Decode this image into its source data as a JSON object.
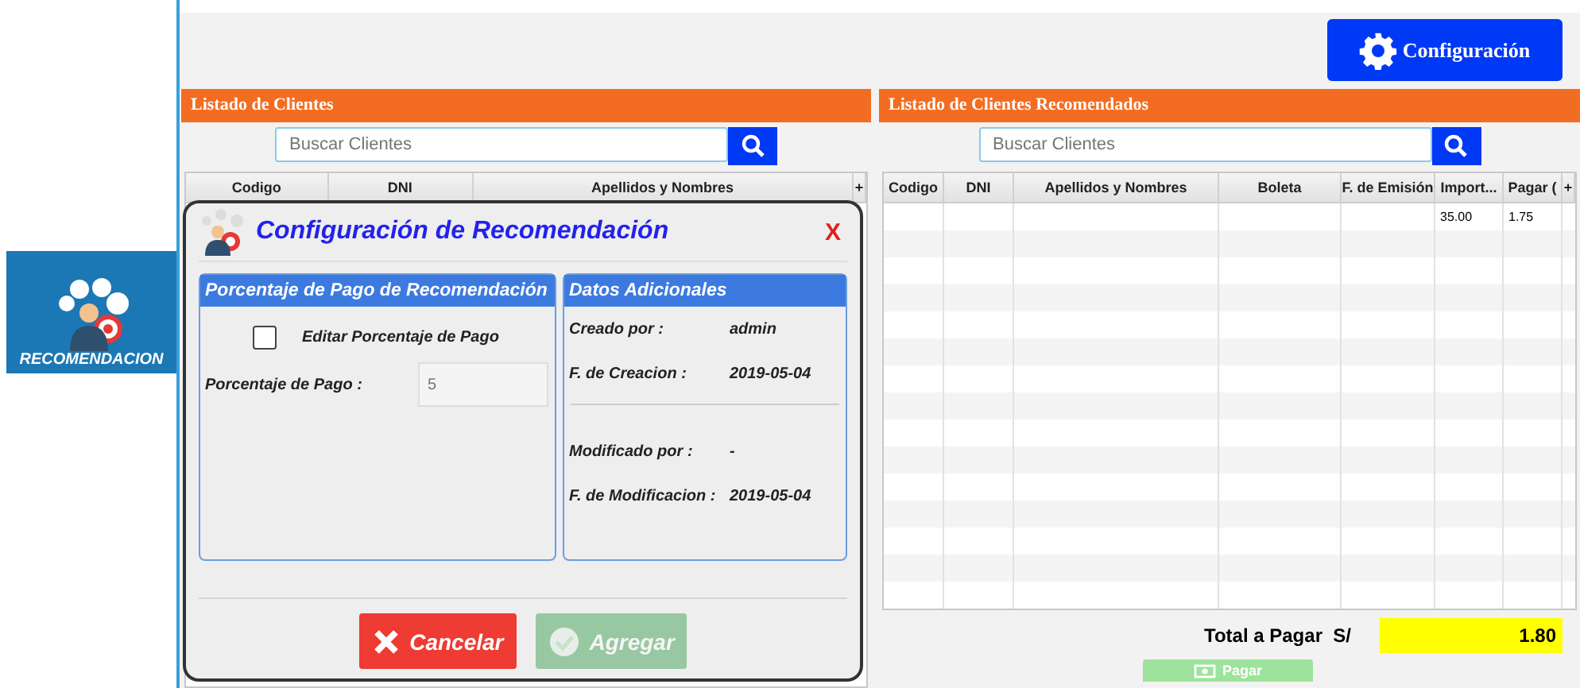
{
  "sidebar_tile": {
    "label": "RECOMENDACION"
  },
  "toolbar": {
    "config_button": "Configuración"
  },
  "clients_panel": {
    "title": "Listado de Clientes",
    "search": {
      "placeholder": "Buscar Clientes"
    },
    "columns": [
      "Codigo",
      "DNI",
      "Apellidos y Nombres"
    ],
    "add_column": "+"
  },
  "recommended_panel": {
    "title": "Listado de Clientes Recomendados",
    "search": {
      "placeholder": "Buscar Clientes"
    },
    "columns": [
      "Codigo",
      "DNI",
      "Apellidos y Nombres",
      "Boleta",
      "F. de Emisión",
      "Import...",
      "Pagar ("
    ],
    "add_column": "+",
    "rows": [
      {
        "cells": [
          "",
          "",
          "",
          "",
          "",
          "35.00",
          "1.75"
        ]
      }
    ]
  },
  "total": {
    "label": "Total a Pagar  S/",
    "value": "1.80"
  },
  "pay_button": {
    "label": "Pagar",
    "disabled": true
  },
  "dialog": {
    "title": "Configuración de Recomendación",
    "close": "X",
    "left_group": {
      "title": "Porcentaje de Pago de Recomendación",
      "checkbox": {
        "label": "Editar Porcentaje de Pago",
        "checked": false
      },
      "field": {
        "label": "Porcentaje de Pago :",
        "value": "5",
        "disabled": true
      }
    },
    "right_group": {
      "title": "Datos Adicionales",
      "sections": [
        [
          {
            "label": "Creado por :",
            "value": "admin"
          },
          {
            "label": "F. de Creacion :",
            "value": "2019-05-04"
          }
        ],
        [
          {
            "label": "Modificado por :",
            "value": "-"
          },
          {
            "label": "F. de Modificacion :",
            "value": "2019-05-04"
          }
        ]
      ]
    },
    "buttons": [
      {
        "label": "Cancelar",
        "kind": "cancel",
        "disabled": false
      },
      {
        "label": "Agregar",
        "kind": "add",
        "disabled": true
      }
    ]
  }
}
